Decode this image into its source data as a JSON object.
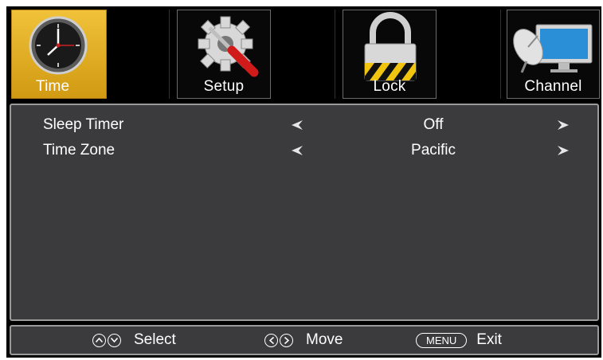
{
  "tabs": [
    {
      "label": "Time",
      "icon": "clock-icon",
      "active": true
    },
    {
      "label": "Setup",
      "icon": "gear-wrench-icon",
      "active": false
    },
    {
      "label": "Lock",
      "icon": "padlock-icon",
      "active": false
    },
    {
      "label": "Channel",
      "icon": "satellite-monitor-icon",
      "active": false
    }
  ],
  "menu": {
    "rows": [
      {
        "name": "Sleep Timer",
        "value": "Off"
      },
      {
        "name": "Time Zone",
        "value": "Pacific"
      }
    ]
  },
  "footer": {
    "select_label": "Select",
    "move_label": "Move",
    "menu_key": "MENU",
    "exit_label": "Exit"
  },
  "colors": {
    "active_tab": "#e2ae22",
    "panel_bg": "#3b3b3d",
    "panel_border": "#9a9a9a"
  }
}
